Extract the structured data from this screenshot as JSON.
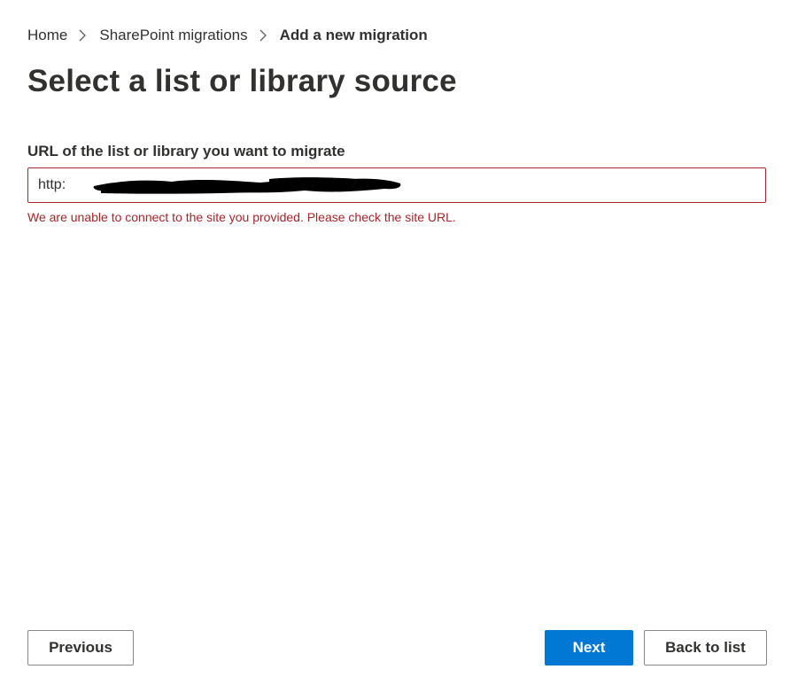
{
  "breadcrumb": {
    "items": [
      {
        "label": "Home"
      },
      {
        "label": "SharePoint migrations"
      },
      {
        "label": "Add a new migration"
      }
    ],
    "separator_icon": "chevron-right-icon"
  },
  "page": {
    "title": "Select a list or library source"
  },
  "url_field": {
    "label": "URL of the list or library you want to migrate",
    "value": "http:",
    "error": "We are unable to connect to the site you provided. Please check the site URL.",
    "error_color": "#a4262c"
  },
  "footer": {
    "previous_label": "Previous",
    "next_label": "Next",
    "back_label": "Back to list"
  },
  "colors": {
    "primary": "#0078d4",
    "text": "#323130",
    "error": "#a4262c"
  }
}
